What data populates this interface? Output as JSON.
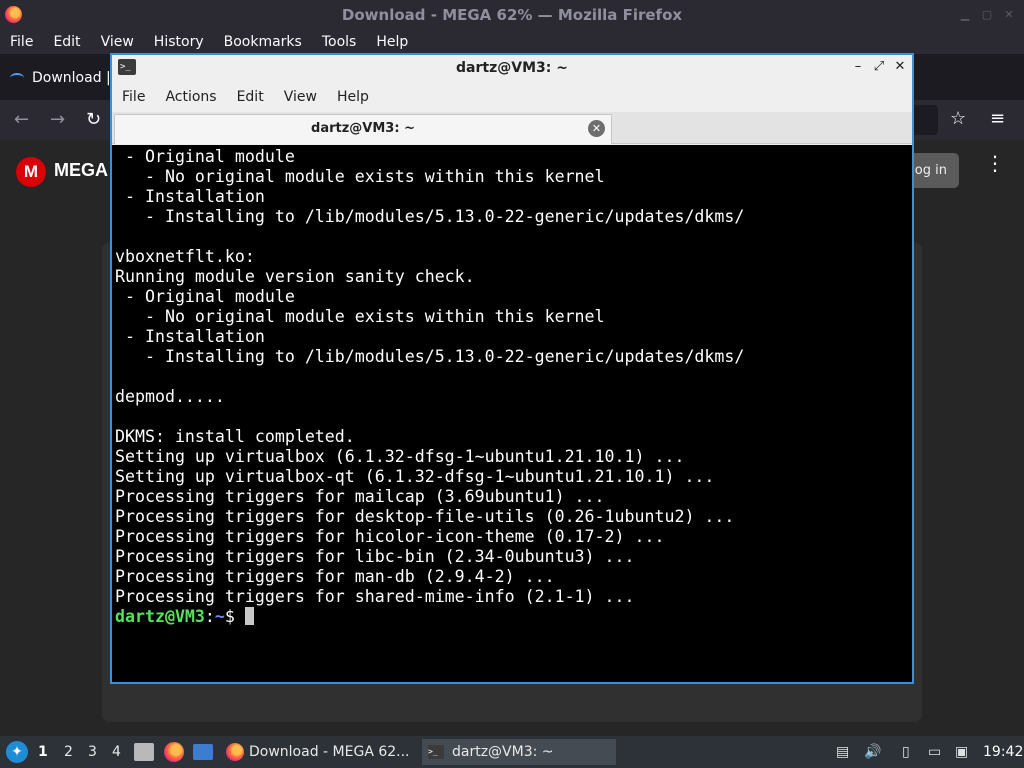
{
  "firefox": {
    "window_title": "Download - MEGA 62% — Mozilla Firefox",
    "menu": [
      "File",
      "Edit",
      "View",
      "History",
      "Bookmarks",
      "Tools",
      "Help"
    ],
    "tab_label": "Download |",
    "page": {
      "logo_letter": "M",
      "brand": "MEGA",
      "login_label": "og in"
    }
  },
  "terminal": {
    "window_title": "dartz@VM3: ~",
    "menu": [
      "File",
      "Actions",
      "Edit",
      "View",
      "Help"
    ],
    "tab_title": "dartz@VM3: ~",
    "lines": [
      " - Original module",
      "   - No original module exists within this kernel",
      " - Installation",
      "   - Installing to /lib/modules/5.13.0-22-generic/updates/dkms/",
      "",
      "vboxnetflt.ko:",
      "Running module version sanity check.",
      " - Original module",
      "   - No original module exists within this kernel",
      " - Installation",
      "   - Installing to /lib/modules/5.13.0-22-generic/updates/dkms/",
      "",
      "depmod.....",
      "",
      "DKMS: install completed.",
      "Setting up virtualbox (6.1.32-dfsg-1~ubuntu1.21.10.1) ...",
      "Setting up virtualbox-qt (6.1.32-dfsg-1~ubuntu1.21.10.1) ...",
      "Processing triggers for mailcap (3.69ubuntu1) ...",
      "Processing triggers for desktop-file-utils (0.26-1ubuntu2) ...",
      "Processing triggers for hicolor-icon-theme (0.17-2) ...",
      "Processing triggers for libc-bin (2.34-0ubuntu3) ...",
      "Processing triggers for man-db (2.9.4-2) ...",
      "Processing triggers for shared-mime-info (2.1-1) ..."
    ],
    "prompt": {
      "user_host": "dartz@VM3",
      "separator": ":",
      "path": "~",
      "symbol": "$ "
    }
  },
  "taskbar": {
    "workspaces": [
      "1",
      "2",
      "3",
      "4"
    ],
    "tasks": [
      {
        "label": "Download - MEGA 62..."
      },
      {
        "label": "dartz@VM3: ~"
      }
    ],
    "clock": "19:42"
  }
}
